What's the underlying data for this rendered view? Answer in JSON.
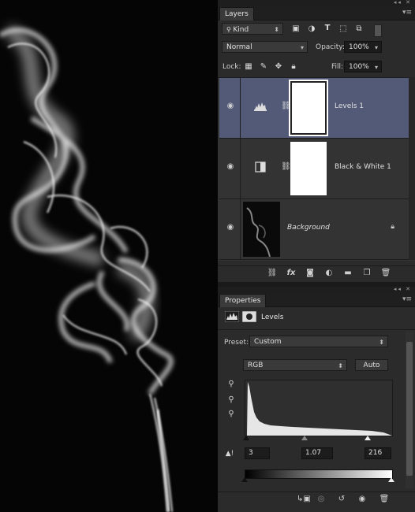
{
  "layers_panel": {
    "tab": "Layers",
    "filter_kind": "Kind",
    "blend_mode": "Normal",
    "opacity_label": "Opacity:",
    "opacity_value": "100%",
    "lock_label": "Lock:",
    "fill_label": "Fill:",
    "fill_value": "100%",
    "layers": [
      {
        "name": "Levels 1",
        "selected": true
      },
      {
        "name": "Black & White 1",
        "selected": false
      },
      {
        "name": "Background",
        "selected": false
      }
    ]
  },
  "properties_panel": {
    "tab": "Properties",
    "title": "Levels",
    "preset_label": "Preset:",
    "preset_value": "Custom",
    "channel": "RGB",
    "auto_label": "Auto",
    "input_black": "3",
    "input_gamma": "1.07",
    "input_white": "216"
  },
  "icons": [
    "eye-icon",
    "chain-link-icon",
    "lock-icon",
    "search-icon",
    "link-icon",
    "fx-icon",
    "mask-icon",
    "adjustment-icon",
    "folder-icon",
    "new-layer-icon",
    "trash-icon",
    "eyedropper-icon",
    "clip-icon",
    "reset-icon",
    "visibility-icon"
  ],
  "colors": {
    "panel_bg": "#2b2b2b",
    "selected_layer": "#535a78",
    "canvas_bg": "#050505"
  }
}
